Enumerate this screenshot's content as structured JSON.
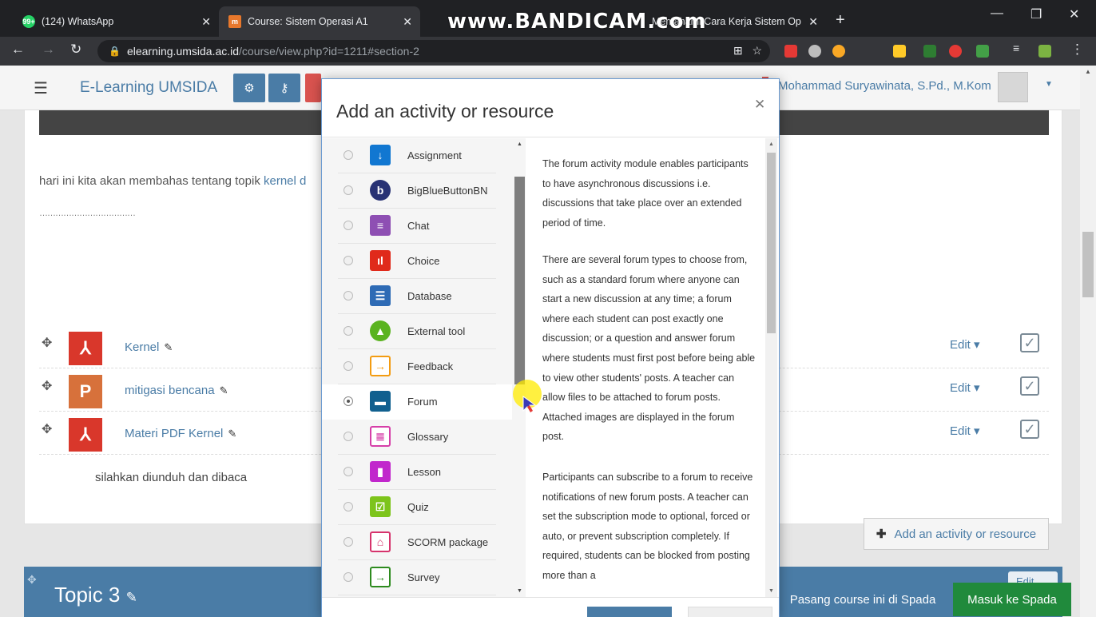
{
  "browser": {
    "tabs": [
      {
        "title": "(124) WhatsApp",
        "badge": "99+"
      },
      {
        "title": "Course: Sistem Operasi A1",
        "active": true
      },
      {
        "title": "Memahami Cara Kerja Sistem Op"
      }
    ],
    "watermark": "www.BANDICAM.com",
    "url_host": "elearning.umsida.ac.id",
    "url_path": "/course/view.php?id=1211#section-2"
  },
  "navbar": {
    "brand": "E-Learning UMSIDA",
    "user_name": "Mohammad Suryawinata, S.Pd., M.Kom"
  },
  "section": {
    "summary_text": "hari ini kita akan membahas tentang topik ",
    "summary_link": "kernel d",
    "dots": "………………………………",
    "activities": [
      {
        "name": "Kernel",
        "icon": "pdf-icon",
        "edit": "Edit"
      },
      {
        "name": "mitigasi bencana",
        "icon": "powerpoint-icon",
        "edit": "Edit"
      },
      {
        "name": "Materi PDF Kernel",
        "icon": "pdf-icon",
        "edit": "Edit"
      }
    ],
    "note": "silahkan diunduh dan dibaca",
    "add_button": "Add an activity or resource"
  },
  "topic3": {
    "title": "Topic 3",
    "edit": "Edit"
  },
  "spada": {
    "pasang": "Pasang course ini di Spada",
    "masuk": "Masuk ke Spada"
  },
  "modal": {
    "title": "Add an activity or resource",
    "options": [
      {
        "label": "Assignment",
        "icon": "assignment-icon",
        "color": "#1177d1"
      },
      {
        "label": "BigBlueButtonBN",
        "icon": "bigbluebutton-icon",
        "color": "#283274"
      },
      {
        "label": "Chat",
        "icon": "chat-icon",
        "color": "#8e4fb3"
      },
      {
        "label": "Choice",
        "icon": "choice-icon",
        "color": "#e02a1b"
      },
      {
        "label": "Database",
        "icon": "database-icon",
        "color": "#2e6bb5"
      },
      {
        "label": "External tool",
        "icon": "external-tool-icon",
        "color": "#5ab31f"
      },
      {
        "label": "Feedback",
        "icon": "feedback-icon",
        "color": "#f39c12"
      },
      {
        "label": "Forum",
        "icon": "forum-icon",
        "color": "#11608f",
        "selected": true
      },
      {
        "label": "Glossary",
        "icon": "glossary-icon",
        "color": "#d63ea8"
      },
      {
        "label": "Lesson",
        "icon": "lesson-icon",
        "color": "#c127cc"
      },
      {
        "label": "Quiz",
        "icon": "quiz-icon",
        "color": "#7dc41b"
      },
      {
        "label": "SCORM package",
        "icon": "scorm-icon",
        "color": "#d6336c"
      },
      {
        "label": "Survey",
        "icon": "survey-icon",
        "color": "#2e8b1f"
      }
    ],
    "help": [
      "The forum activity module enables participants to have asynchronous discussions i.e. discussions that take place over an extended period of time.",
      "There are several forum types to choose from, such as a standard forum where anyone can start a new discussion at any time; a forum where each student can post exactly one discussion; or a question and answer forum where students must first post before being able to view other students' posts. A teacher can allow files to be attached to forum posts. Attached images are displayed in the forum post.",
      "Participants can subscribe to a forum to receive notifications of new forum posts. A teacher can set the subscription mode to optional, forced or auto, or prevent subscription completely. If required, students can be blocked from posting more than a"
    ]
  }
}
